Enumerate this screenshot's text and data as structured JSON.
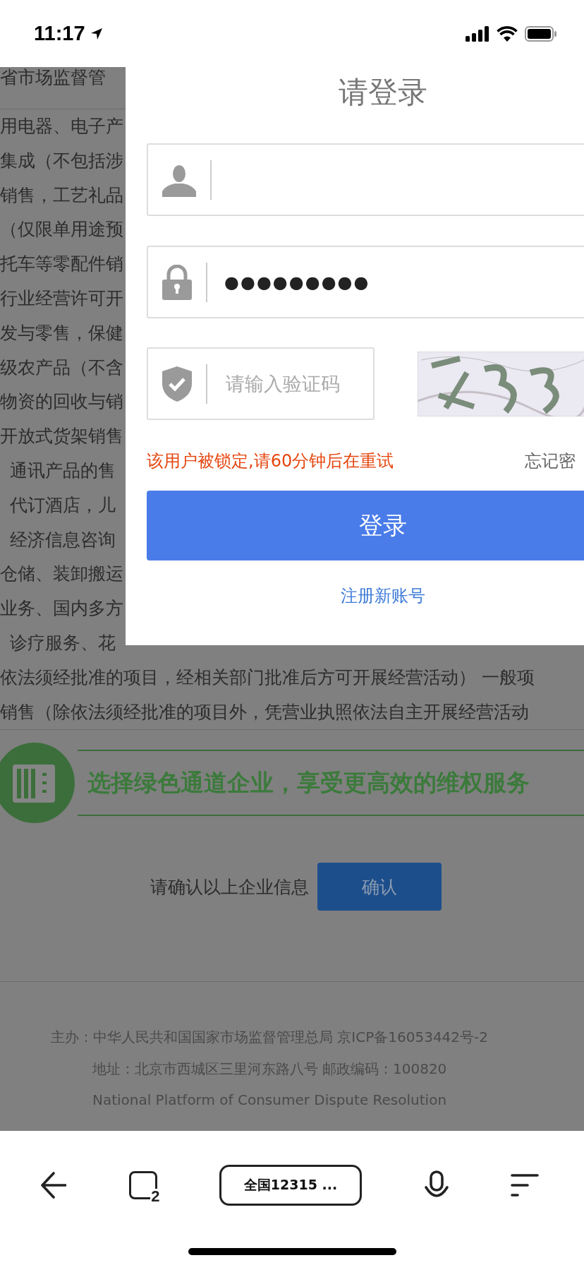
{
  "status_bar": {
    "time": "11:17"
  },
  "page": {
    "header_fragment": "省市场监督管",
    "scope_lines": [
      {
        "text": "用电器、电子产",
        "indented": false
      },
      {
        "text": "集成（不包括涉",
        "indented": false
      },
      {
        "text": "销售，工艺礼品",
        "indented": false
      },
      {
        "text": "（仅限单用途预",
        "indented": false
      },
      {
        "text": "托车等零配件销",
        "indented": false
      },
      {
        "text": "行业经营许可开",
        "indented": false
      },
      {
        "text": "发与零售，保健",
        "indented": false
      },
      {
        "text": "级农产品（不含",
        "indented": false
      },
      {
        "text": "物资的回收与销",
        "indented": false
      },
      {
        "text": "开放式货架销售",
        "indented": false
      },
      {
        "text": "通讯产品的售",
        "indented": true
      },
      {
        "text": "代订酒店，儿",
        "indented": true
      },
      {
        "text": "经济信息咨询",
        "indented": true
      },
      {
        "text": "仓储、装卸搬运",
        "indented": false
      },
      {
        "text": "业务、国内多方",
        "indented": false
      },
      {
        "text": "诊疗服务、花",
        "indented": true
      },
      {
        "text": "依法须经批准的项目，经相关部门批准后方可开展经营活动） 一般项",
        "indented": false
      },
      {
        "text": "销售（除依法须经批准的项目外，凭营业执照依法自主开展经营活动",
        "indented": false
      }
    ],
    "banner": {
      "text": "选择绿色通道企业，享受更高效的维权服务"
    },
    "confirm": {
      "prompt": "请确认以上企业信息",
      "button": "确认"
    },
    "footer": [
      "主办：中华人民共和国国家市场监督管理总局 京ICP备16053442号-2",
      "地址：北京市西城区三里河东路八号 邮政编码：100820",
      "National Platform of Consumer Dispute Resolution"
    ]
  },
  "login_dialog": {
    "title": "请登录",
    "password": {
      "value": "●●●●●●●●●"
    },
    "captcha": {
      "placeholder": "请输入验证码"
    },
    "error": "该用户被锁定,请60分钟后在重试",
    "forgot_link": "忘记密",
    "login_button": "登录",
    "register_link": "注册新账号"
  },
  "browser_bar": {
    "tab_count": "2",
    "address": "全国12315 ..."
  }
}
